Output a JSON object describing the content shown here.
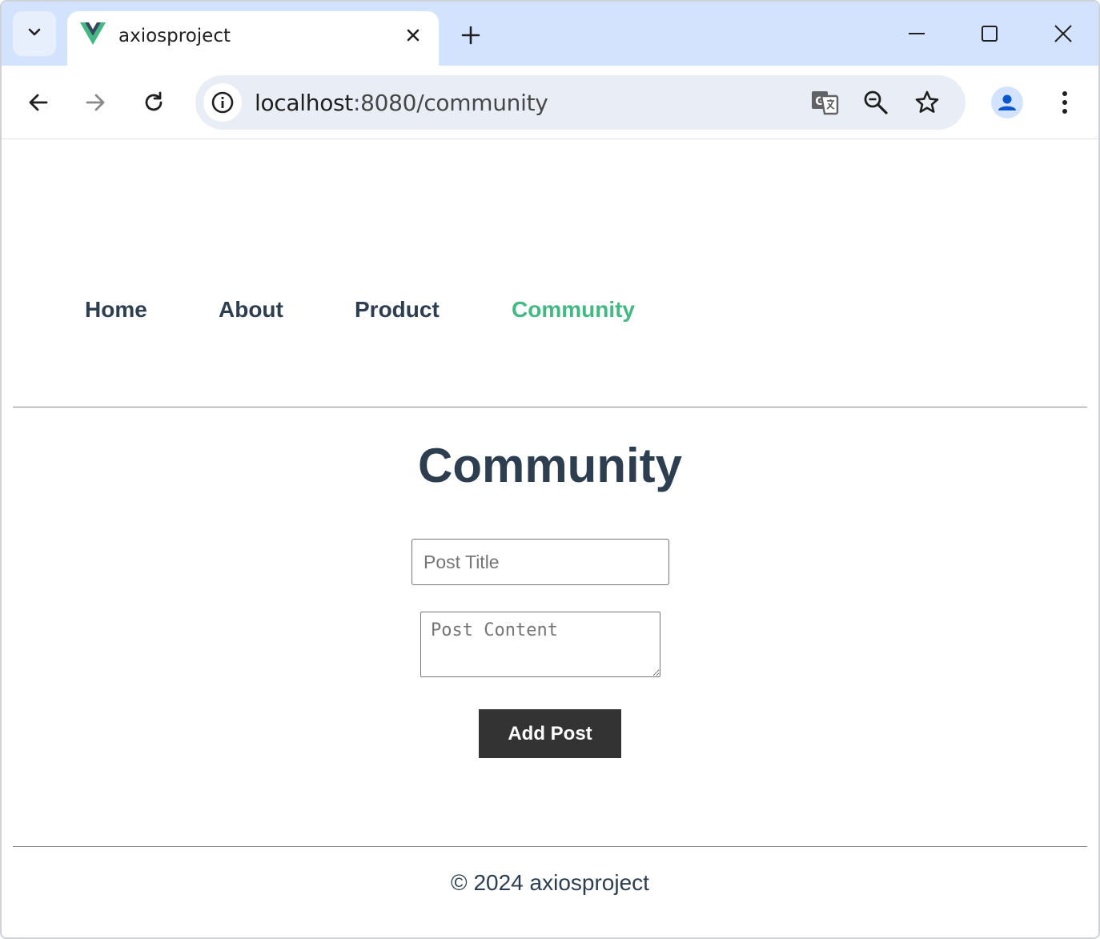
{
  "browser": {
    "tab_title": "axiosproject",
    "url_host": "localhost",
    "url_path": ":8080/community"
  },
  "nav": {
    "items": [
      {
        "label": "Home",
        "active": false
      },
      {
        "label": "About",
        "active": false
      },
      {
        "label": "Product",
        "active": false
      },
      {
        "label": "Community",
        "active": true
      }
    ]
  },
  "main": {
    "heading": "Community",
    "title_placeholder": "Post Title",
    "title_value": "",
    "content_placeholder": "Post Content",
    "content_value": "",
    "add_button_label": "Add Post"
  },
  "footer": {
    "text": "© 2024 axiosproject"
  },
  "colors": {
    "active_link": "#42b983",
    "text": "#2c3e50",
    "button_bg": "#333333",
    "tabstrip_bg": "#d3e3fd"
  },
  "icons": [
    "tab-search-icon",
    "vue-logo-icon",
    "close-icon",
    "plus-icon",
    "minimize-icon",
    "maximize-icon",
    "window-close-icon",
    "back-icon",
    "forward-icon",
    "reload-icon",
    "info-icon",
    "translate-icon",
    "zoom-icon",
    "star-icon",
    "profile-icon",
    "more-menu-icon"
  ]
}
